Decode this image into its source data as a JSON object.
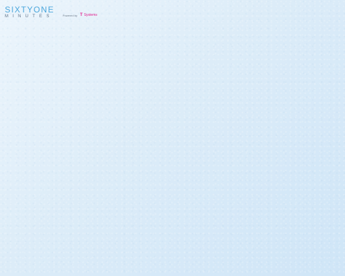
{
  "header": {
    "logo_top": "SIXTYONE",
    "logo_bottom": "MINUTES",
    "powered_label": "Powered by",
    "brand_mark": "T",
    "brand_name": "Systems"
  },
  "colors": {
    "accent": "#4aa6dc",
    "brand": "#e0208c",
    "background": "#dcecf8"
  }
}
